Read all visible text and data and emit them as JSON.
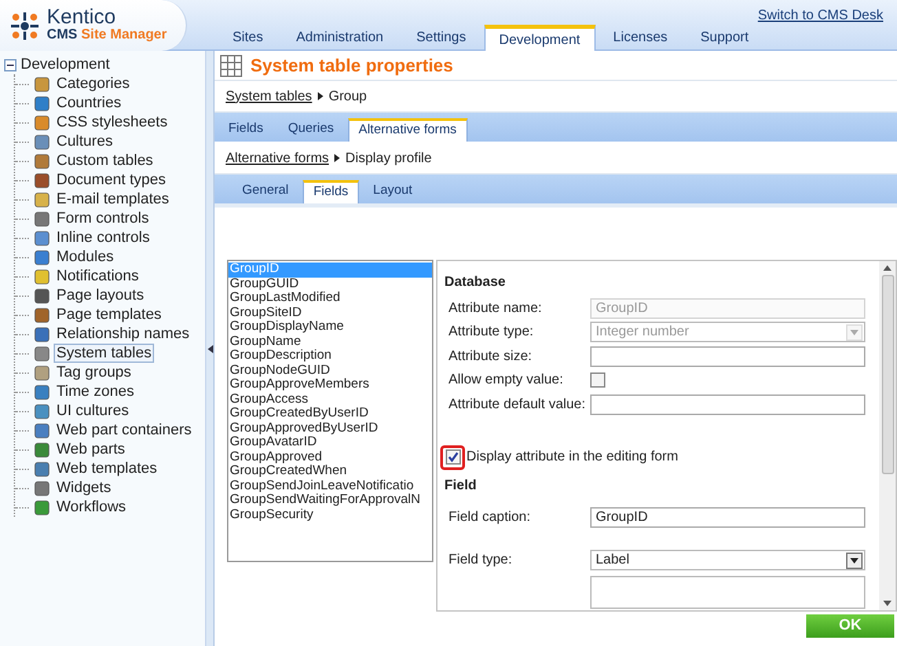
{
  "header": {
    "logo_name": "Kentico",
    "logo_prefix": "CMS",
    "logo_product": "Site Manager",
    "switch_link": "Switch to CMS Desk",
    "tabs": [
      {
        "label": "Sites",
        "selected": false
      },
      {
        "label": "Administration",
        "selected": false
      },
      {
        "label": "Settings",
        "selected": false
      },
      {
        "label": "Development",
        "selected": true
      },
      {
        "label": "Licenses",
        "selected": false
      },
      {
        "label": "Support",
        "selected": false
      }
    ]
  },
  "sidebar": {
    "tree": {
      "label": "Development",
      "expanded": true,
      "children": [
        {
          "label": "Categories",
          "selected": false
        },
        {
          "label": "Countries",
          "selected": false
        },
        {
          "label": "CSS stylesheets",
          "selected": false
        },
        {
          "label": "Cultures",
          "selected": false
        },
        {
          "label": "Custom tables",
          "selected": false
        },
        {
          "label": "Document types",
          "selected": false
        },
        {
          "label": "E-mail templates",
          "selected": false
        },
        {
          "label": "Form controls",
          "selected": false
        },
        {
          "label": "Inline controls",
          "selected": false
        },
        {
          "label": "Modules",
          "selected": false
        },
        {
          "label": "Notifications",
          "selected": false
        },
        {
          "label": "Page layouts",
          "selected": false
        },
        {
          "label": "Page templates",
          "selected": false
        },
        {
          "label": "Relationship names",
          "selected": false
        },
        {
          "label": "System tables",
          "selected": true
        },
        {
          "label": "Tag groups",
          "selected": false
        },
        {
          "label": "Time zones",
          "selected": false
        },
        {
          "label": "UI cultures",
          "selected": false
        },
        {
          "label": "Web part containers",
          "selected": false
        },
        {
          "label": "Web parts",
          "selected": false
        },
        {
          "label": "Web templates",
          "selected": false
        },
        {
          "label": "Widgets",
          "selected": false
        },
        {
          "label": "Workflows",
          "selected": false
        }
      ]
    }
  },
  "page": {
    "title": "System table properties",
    "breadcrumb": [
      {
        "text": "System tables",
        "kind": "link"
      },
      {
        "text": "Group",
        "kind": "current"
      }
    ],
    "tabs": [
      {
        "label": "Fields",
        "selected": false
      },
      {
        "label": "Queries",
        "selected": false
      },
      {
        "label": "Alternative forms",
        "selected": true
      }
    ],
    "sub_breadcrumb": [
      {
        "text": "Alternative forms",
        "kind": "link"
      },
      {
        "text": "Display profile",
        "kind": "current"
      }
    ],
    "sub_tabs": [
      {
        "label": "General",
        "selected": false
      },
      {
        "label": "Fields",
        "selected": true
      },
      {
        "label": "Layout",
        "selected": false
      }
    ],
    "field_list": [
      {
        "label": "GroupID",
        "selected": true
      },
      {
        "label": "GroupGUID",
        "selected": false
      },
      {
        "label": "GroupLastModified",
        "selected": false
      },
      {
        "label": "GroupSiteID",
        "selected": false
      },
      {
        "label": "GroupDisplayName",
        "selected": false
      },
      {
        "label": "GroupName",
        "selected": false
      },
      {
        "label": "GroupDescription",
        "selected": false
      },
      {
        "label": "GroupNodeGUID",
        "selected": false
      },
      {
        "label": "GroupApproveMembers",
        "selected": false
      },
      {
        "label": "GroupAccess",
        "selected": false
      },
      {
        "label": "GroupCreatedByUserID",
        "selected": false
      },
      {
        "label": "GroupApprovedByUserID",
        "selected": false
      },
      {
        "label": "GroupAvatarID",
        "selected": false
      },
      {
        "label": "GroupApproved",
        "selected": false
      },
      {
        "label": "GroupCreatedWhen",
        "selected": false
      },
      {
        "label": "GroupSendJoinLeaveNotificatio",
        "selected": false
      },
      {
        "label": "GroupSendWaitingForApprovalN",
        "selected": false
      },
      {
        "label": "GroupSecurity",
        "selected": false
      }
    ],
    "properties": [
      {
        "kind": "heading",
        "label": "Database"
      },
      {
        "kind": "text",
        "label": "Attribute name:",
        "value": "GroupID",
        "disabled": true
      },
      {
        "kind": "select",
        "label": "Attribute type:",
        "value": "Integer number",
        "disabled": true
      },
      {
        "kind": "text",
        "label": "Attribute size:",
        "disabled": false
      },
      {
        "kind": "checkbox",
        "label": "Allow empty value:",
        "checked": false
      },
      {
        "kind": "text",
        "label": "Attribute default value:",
        "disabled": false
      },
      {
        "kind": "option",
        "label": "Display attribute in the editing form",
        "checked": true,
        "highlighted": true
      },
      {
        "kind": "heading",
        "label": "Field"
      },
      {
        "kind": "text",
        "label": "Field caption:",
        "value": "GroupID",
        "disabled": false
      },
      {
        "kind": "select",
        "label": "Field type:",
        "value": "Label",
        "disabled": false
      },
      {
        "kind": "textarea"
      }
    ],
    "ok_button": "OK"
  }
}
